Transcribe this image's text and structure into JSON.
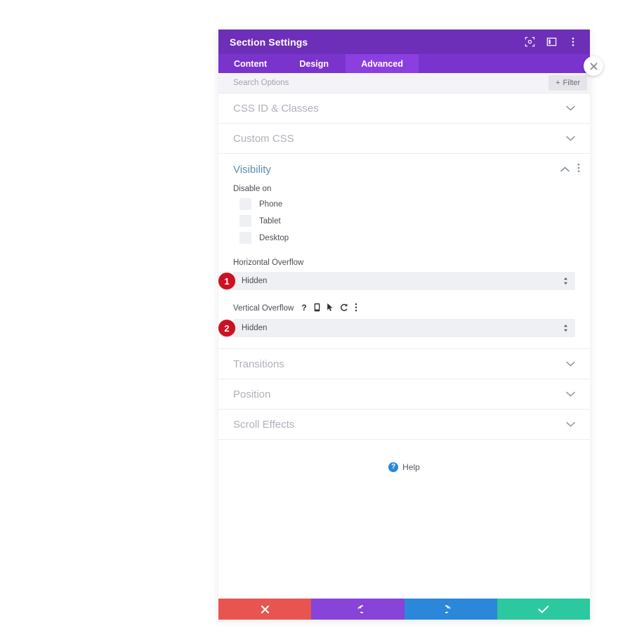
{
  "window": {
    "title": "Section Settings",
    "header_icons": [
      {
        "name": "focus-icon",
        "title": "Focus"
      },
      {
        "name": "layout-panel-icon",
        "title": "Panel layout"
      },
      {
        "name": "more-vertical-icon",
        "title": "More options"
      }
    ]
  },
  "tabs": [
    {
      "label": "Content",
      "active": false
    },
    {
      "label": "Design",
      "active": false
    },
    {
      "label": "Advanced",
      "active": true
    }
  ],
  "search": {
    "placeholder": "Search Options",
    "value": "",
    "filter_label": "Filter",
    "filter_plus": "+"
  },
  "sections": {
    "css_id_classes": {
      "label": "CSS ID & Classes",
      "state": "collapsed"
    },
    "custom_css": {
      "label": "Custom CSS",
      "state": "collapsed"
    },
    "visibility": {
      "label": "Visibility",
      "state": "expanded"
    },
    "transitions": {
      "label": "Transitions",
      "state": "collapsed"
    },
    "position": {
      "label": "Position",
      "state": "collapsed"
    },
    "scroll_effects": {
      "label": "Scroll Effects",
      "state": "collapsed"
    }
  },
  "visibility": {
    "disable_on_label": "Disable on",
    "checkboxes": [
      {
        "label": "Phone",
        "checked": false
      },
      {
        "label": "Tablet",
        "checked": false
      },
      {
        "label": "Desktop",
        "checked": false
      }
    ],
    "horizontal_overflow": {
      "label": "Horizontal Overflow",
      "value": "Hidden",
      "badge": "1"
    },
    "vertical_overflow": {
      "label": "Vertical Overflow",
      "value": "Hidden",
      "badge": "2",
      "tool_icons": [
        {
          "name": "help-question-icon"
        },
        {
          "name": "mobile-device-icon"
        },
        {
          "name": "cursor-pointer-icon"
        },
        {
          "name": "reset-undo-icon"
        },
        {
          "name": "more-vertical-icon"
        }
      ]
    }
  },
  "help": {
    "label": "Help",
    "icon_glyph": "?"
  },
  "footer_buttons": [
    {
      "name": "cancel-button",
      "icon": "close-x-icon",
      "color": "#e8544f"
    },
    {
      "name": "undo-button",
      "icon": "undo-icon",
      "color": "#8843d8"
    },
    {
      "name": "redo-button",
      "icon": "redo-icon",
      "color": "#2b87da"
    },
    {
      "name": "save-button",
      "icon": "checkmark-icon",
      "color": "#2cc89f"
    }
  ],
  "close_overlay": {
    "name": "close-modal-button"
  },
  "colors": {
    "header_purple": "#6d2eb8",
    "tabbar_purple": "#7a33cc",
    "active_tab_purple": "#8b3fe0",
    "badge_red": "#cc1122",
    "section_open_blue": "#5a8fae",
    "field_bg": "#eef0f4"
  }
}
